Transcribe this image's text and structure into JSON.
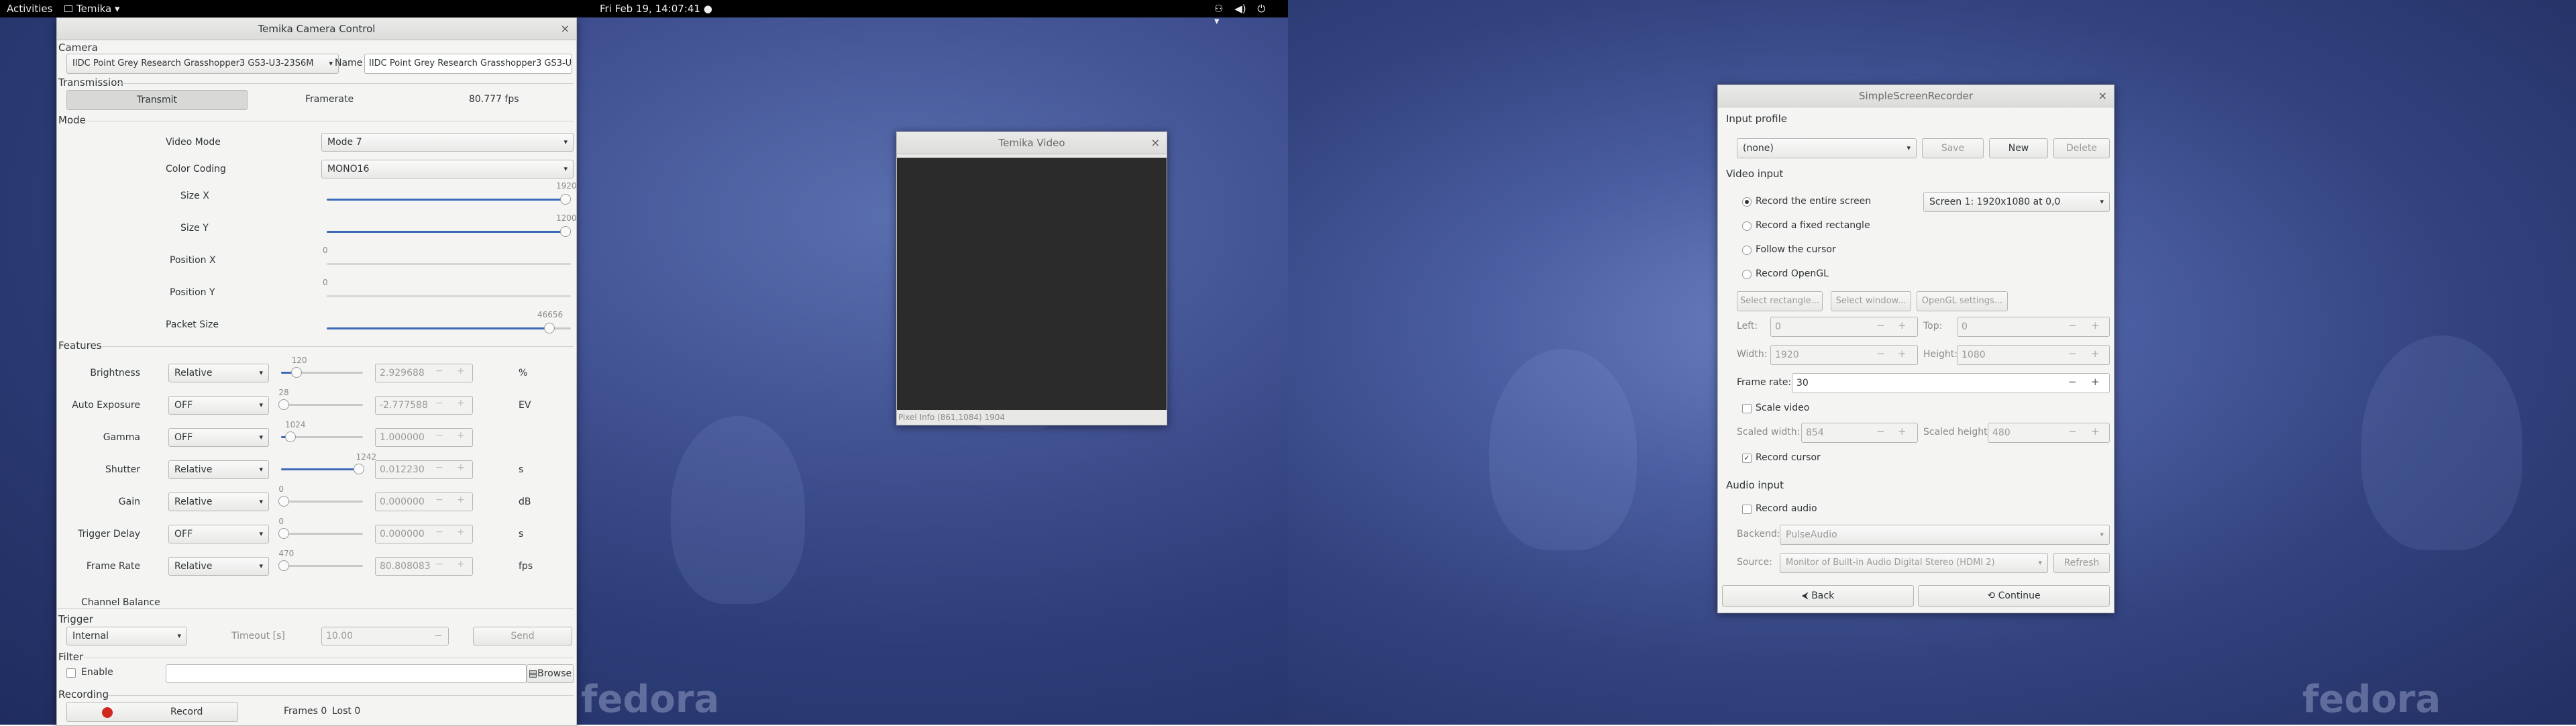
{
  "topbar": {
    "activities": "Activities",
    "app": "Temika",
    "app_arrow": "▾",
    "clock": "Fri Feb 19, 14:07:41 ●",
    "icons": [
      "⚇",
      "◀)",
      "⏻",
      "▾"
    ]
  },
  "camera": {
    "title": "Temika Camera Control",
    "close": "×",
    "camera_label": "Camera",
    "device": "IIDC Point Grey Research Grasshopper3 GS3-U3-23S6M",
    "name_label": "Name",
    "name_value": "IIDC Point Grey Research Grasshopper3 GS3-U3-23S6M",
    "transmission_label": "Transmission",
    "transmit": "Transmit",
    "framerate_label": "Framerate",
    "fps_value": "80.777 fps",
    "mode_label": "Mode",
    "video_mode_label": "Video Mode",
    "video_mode": "Mode 7",
    "color_coding_label": "Color Coding",
    "color_coding": "MONO16",
    "sizex_label": "Size X",
    "sizex_val": "1920",
    "sizey_label": "Size Y",
    "sizey_val": "1200",
    "posx_label": "Position X",
    "posx_val": "0",
    "posy_label": "Position Y",
    "posy_val": "0",
    "packet_label": "Packet Size",
    "packet_val": "46656",
    "features_label": "Features",
    "features": [
      {
        "name": "Brightness",
        "mode": "Relative",
        "slider": "120",
        "value": "2.929688",
        "unit": "%"
      },
      {
        "name": "Auto Exposure",
        "mode": "OFF",
        "slider": "28",
        "value": "-2.777588",
        "unit": "EV"
      },
      {
        "name": "Gamma",
        "mode": "OFF",
        "slider": "1024",
        "value": "1.000000",
        "unit": ""
      },
      {
        "name": "Shutter",
        "mode": "Relative",
        "slider": "1242",
        "value": "0.012230",
        "unit": "s"
      },
      {
        "name": "Gain",
        "mode": "Relative",
        "slider": "0",
        "value": "0.000000",
        "unit": "dB"
      },
      {
        "name": "Trigger Delay",
        "mode": "OFF",
        "slider": "0",
        "value": "0.000000",
        "unit": "s"
      },
      {
        "name": "Frame Rate",
        "mode": "Relative",
        "slider": "470",
        "value": "80.808083",
        "unit": "fps"
      }
    ],
    "channel_balance": "Channel Balance",
    "trigger_label": "Trigger",
    "trigger_mode": "Internal",
    "timeout_label": "Timeout [s]",
    "timeout_val": "10.00",
    "send": "Send",
    "filter_label": "Filter",
    "enable": "Enable",
    "browse": "Browse",
    "recording_label": "Recording",
    "record": "Record",
    "frames": "Frames 0",
    "lost": "Lost 0",
    "minus": "−",
    "plus": "+",
    "arrow": "▾"
  },
  "video": {
    "title": "Temika Video",
    "close": "×",
    "pixel_info": "Pixel Info (861,1084) 1904"
  },
  "ssr": {
    "title": "SimpleScreenRecorder",
    "close": "×",
    "input_profile": "Input profile",
    "profile": "(none)",
    "save": "Save",
    "new": "New",
    "delete": "Delete",
    "video_input": "Video input",
    "record_entire": "Record the entire screen",
    "screen": "Screen 1: 1920x1080 at 0,0",
    "record_fixed": "Record a fixed rectangle",
    "follow_cursor": "Follow the cursor",
    "record_opengl": "Record OpenGL",
    "select_rect": "Select rectangle...",
    "select_window": "Select window...",
    "opengl_settings": "OpenGL settings...",
    "left_label": "Left:",
    "left": "0",
    "top_label": "Top:",
    "top": "0",
    "width_label": "Width:",
    "width": "1920",
    "height_label": "Height:",
    "height": "1080",
    "framerate_label": "Frame rate:",
    "framerate": "30",
    "scale_video": "Scale video",
    "scaled_width_label": "Scaled width:",
    "scaled_width": "854",
    "scaled_height_label": "Scaled height:",
    "scaled_height": "480",
    "record_cursor": "Record cursor",
    "check": "✓",
    "audio_input": "Audio input",
    "record_audio": "Record audio",
    "backend_label": "Backend:",
    "backend": "PulseAudio",
    "source_label": "Source:",
    "source": "Monitor of Built-in Audio Digital Stereo (HDMI 2)",
    "refresh": "Refresh",
    "back": "Back",
    "continue": "Continue",
    "back_icon": "⮜",
    "continue_icon": "⟲",
    "minus": "−",
    "plus": "+",
    "arrow": "▾"
  },
  "wallpaper": {
    "logo": "fedora"
  }
}
